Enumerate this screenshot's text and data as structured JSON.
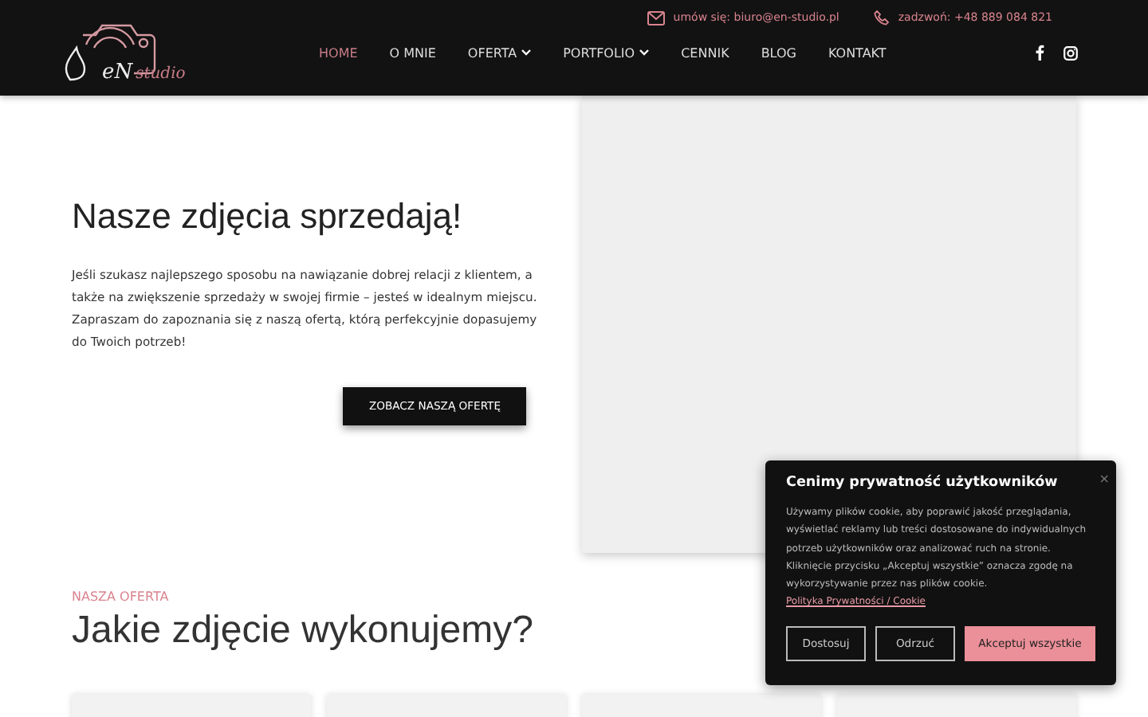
{
  "header": {
    "logo": {
      "letters": "eN",
      "word": "studio"
    },
    "contacts": [
      {
        "kind": "mail",
        "text": "umów się: biuro@en-studio.pl"
      },
      {
        "kind": "phone",
        "text": "zadzwoń: +48 889 084 821"
      }
    ],
    "nav": [
      {
        "label": "HOME",
        "selected": true,
        "dropdown": false
      },
      {
        "label": "O MNIE",
        "selected": false,
        "dropdown": false
      },
      {
        "label": "OFERTA",
        "selected": false,
        "dropdown": true
      },
      {
        "label": "PORTFOLIO",
        "selected": false,
        "dropdown": true
      },
      {
        "label": "CENNIK",
        "selected": false,
        "dropdown": false
      },
      {
        "label": "BLOG",
        "selected": false,
        "dropdown": false
      },
      {
        "label": "KONTAKT",
        "selected": false,
        "dropdown": false
      }
    ],
    "social": [
      {
        "kind": "facebook"
      },
      {
        "kind": "instagram"
      }
    ]
  },
  "hero": {
    "title": "Nasze zdjęcia sprzedają!",
    "text": "Jeśli szukasz najlepszego sposobu na nawiązanie dobrej relacji z klientem, a także na zwiększenie sprzedaży w swojej firmie – jesteś w idealnym miejscu. Zapraszam do zapoznania się z naszą ofertą, którą perfekcyjnie dopasujemy do Twoich potrzeb!",
    "button": "ZOBACZ NASZĄ OFERTĘ"
  },
  "offer": {
    "eyebrow": "NASZA OFERTA",
    "title": "Jakie zdjęcie wykonujemy?"
  },
  "cookie": {
    "close": "×",
    "title": "Cenimy prywatność użytkowników",
    "text": "Używamy plików cookie, aby poprawić jakość przeglądania, wyświetlać reklamy lub treści dostosowane do indywidualnych potrzeb użytkowników oraz analizować ruch na stronie. Kliknięcie przycisku „Akceptuj wszystkie” oznacza zgodę na wykorzystywanie przez nas plików cookie.",
    "link": "Polityka Prywatności / Cookie",
    "buttons": [
      {
        "label": "Dostosuj",
        "kind": "outline"
      },
      {
        "label": "Odrzuć",
        "kind": "outline"
      },
      {
        "label": "Akceptuj wszystkie",
        "kind": "primary"
      }
    ]
  }
}
